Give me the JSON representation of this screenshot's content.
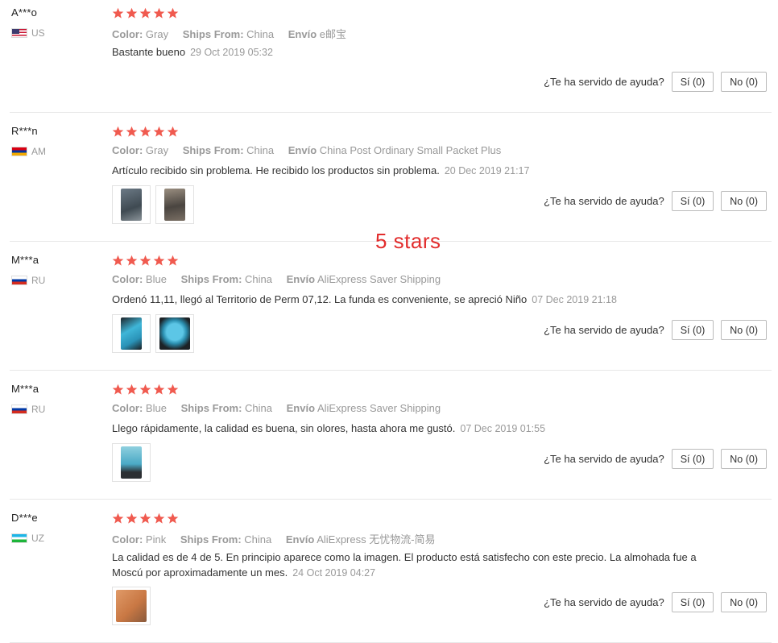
{
  "labels": {
    "color": "Color:",
    "ships_from": "Ships From:",
    "envio": "Envío",
    "helpful_question": "¿Te ha servido de ayuda?"
  },
  "overlay_text": "5 stars",
  "reviews": [
    {
      "user": "A***o",
      "country": "US",
      "rating": 5,
      "color": "Gray",
      "ships_from": "China",
      "envio": "e邮宝",
      "text": "Bastante bueno",
      "date": "29 Oct 2019 05:32",
      "yes": "Sí (0)",
      "no": "No (0)"
    },
    {
      "user": "R***n",
      "country": "AM",
      "rating": 5,
      "color": "Gray",
      "ships_from": "China",
      "envio": "China Post Ordinary Small Packet Plus",
      "text": "Artículo recibido sin problema. He recibido los productos sin problema.",
      "date": "20 Dec 2019 21:17",
      "yes": "Sí (0)",
      "no": "No (0)"
    },
    {
      "user": "M***a",
      "country": "RU",
      "rating": 5,
      "color": "Blue",
      "ships_from": "China",
      "envio": "AliExpress Saver Shipping",
      "text": "Ordenó 11,11, llegó al Territorio de Perm 07,12. La funda es conveniente, se apreció Niño",
      "date": "07 Dec 2019 21:18",
      "yes": "Sí (0)",
      "no": "No (0)"
    },
    {
      "user": "M***a",
      "country": "RU",
      "rating": 5,
      "color": "Blue",
      "ships_from": "China",
      "envio": "AliExpress Saver Shipping",
      "text": "Llego rápidamente, la calidad es buena, sin olores, hasta ahora me gustó.",
      "date": "07 Dec 2019 01:55",
      "yes": "Sí (0)",
      "no": "No (0)"
    },
    {
      "user": "D***e",
      "country": "UZ",
      "rating": 5,
      "color": "Pink",
      "ships_from": "China",
      "envio": "AliExpress 无忧物流-简易",
      "text": "La calidad es de 4 de 5. En principio aparece como la imagen. El producto está satisfecho con este precio. La almohada fue a Moscú por aproximadamente un mes.",
      "date": "24 Oct 2019 04:27",
      "yes": "Sí (0)",
      "no": "No (0)"
    }
  ],
  "colors": {
    "star": "#f05a4f",
    "overlay": "#e22d2d",
    "muted": "#999999"
  }
}
